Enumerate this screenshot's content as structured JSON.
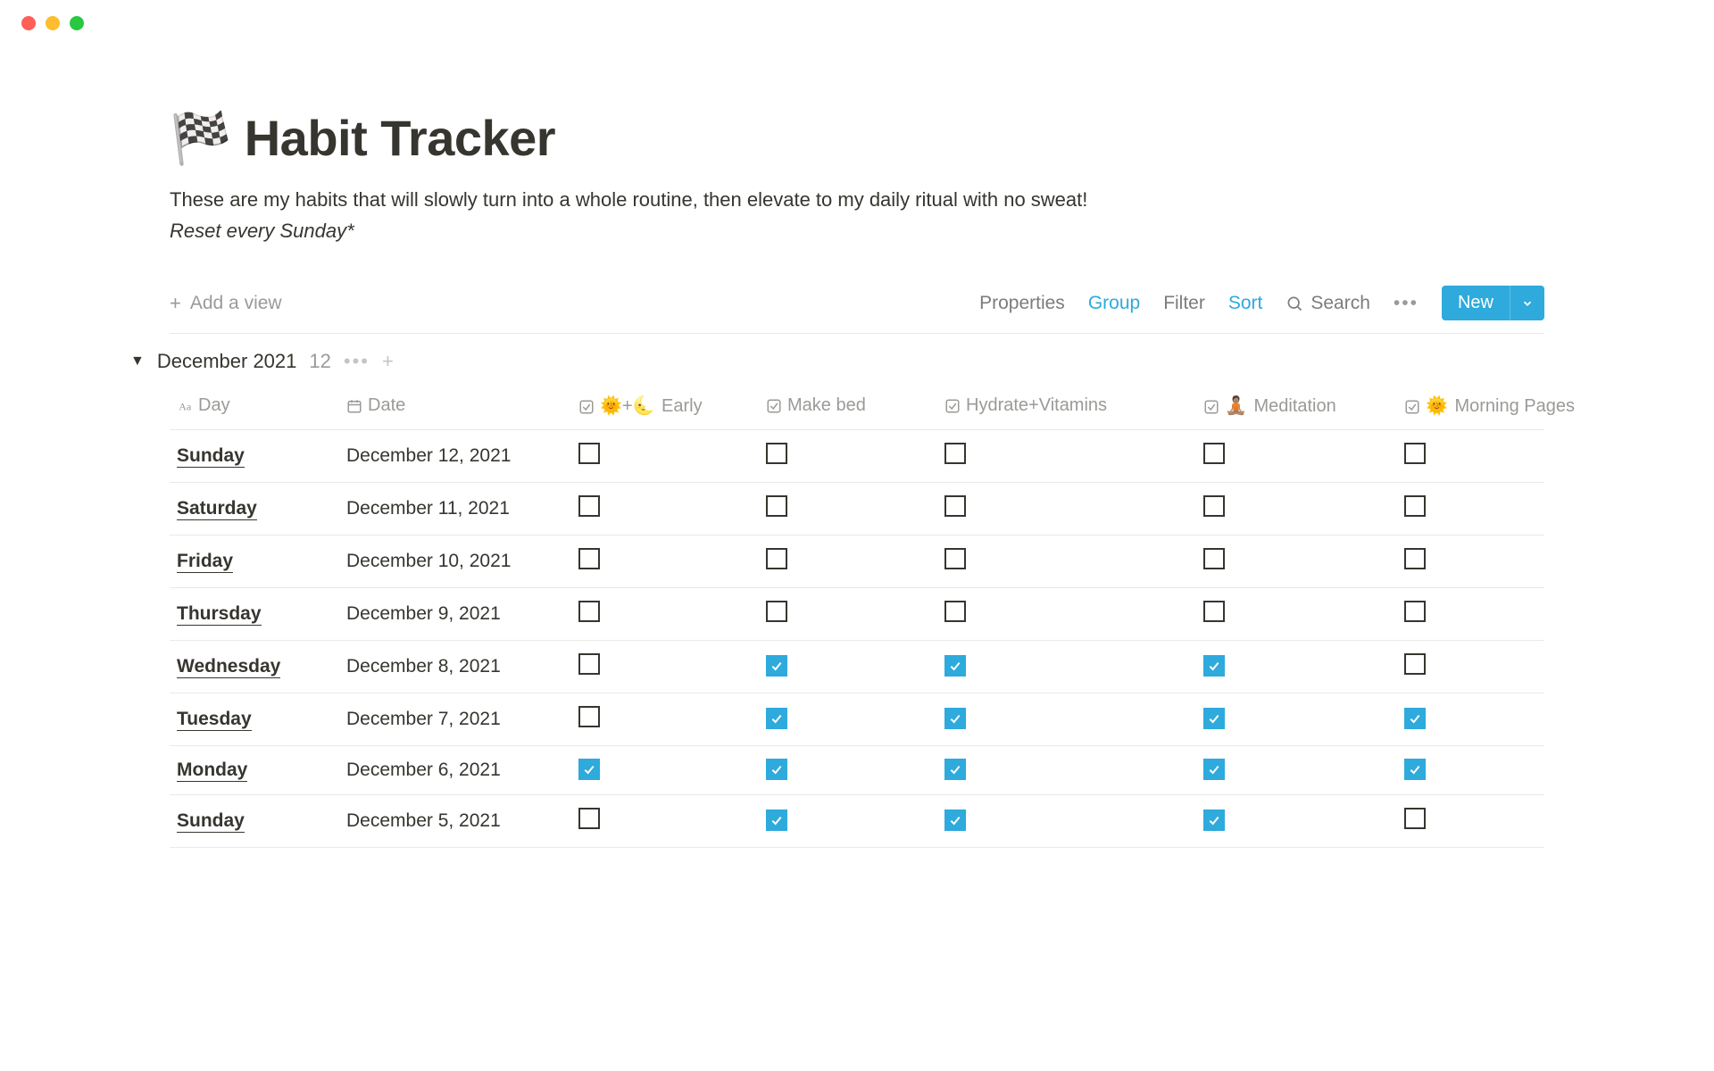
{
  "page": {
    "icon": "🏁",
    "title": "Habit Tracker",
    "description": "These are my habits that will slowly turn into a whole routine, then elevate to my daily ritual with no sweat!",
    "subtitle": "Reset every Sunday*"
  },
  "toolbar": {
    "add_view": "Add a view",
    "properties": "Properties",
    "group": "Group",
    "filter": "Filter",
    "sort": "Sort",
    "search": "Search",
    "new": "New"
  },
  "group": {
    "label": "December 2021",
    "count": "12"
  },
  "columns": [
    {
      "key": "day",
      "label": "Day",
      "icon_type": "title"
    },
    {
      "key": "date",
      "label": "Date",
      "icon_type": "date"
    },
    {
      "key": "early",
      "label": "Early",
      "icon_type": "checkbox",
      "emoji": "🌞+🌜"
    },
    {
      "key": "makebed",
      "label": "Make bed",
      "icon_type": "checkbox",
      "emoji": ""
    },
    {
      "key": "hydrate",
      "label": "Hydrate+Vitamins",
      "icon_type": "checkbox",
      "emoji": ""
    },
    {
      "key": "meditation",
      "label": "Meditation",
      "icon_type": "checkbox",
      "emoji": "🧘🏽"
    },
    {
      "key": "morning",
      "label": "Morning Pages",
      "icon_type": "checkbox",
      "emoji": "🌞"
    }
  ],
  "rows": [
    {
      "day": "Sunday",
      "date": "December 12, 2021",
      "early": false,
      "makebed": false,
      "hydrate": false,
      "meditation": false,
      "morning": false
    },
    {
      "day": "Saturday",
      "date": "December 11, 2021",
      "early": false,
      "makebed": false,
      "hydrate": false,
      "meditation": false,
      "morning": false
    },
    {
      "day": "Friday",
      "date": "December 10, 2021",
      "early": false,
      "makebed": false,
      "hydrate": false,
      "meditation": false,
      "morning": false
    },
    {
      "day": "Thursday",
      "date": "December 9, 2021",
      "early": false,
      "makebed": false,
      "hydrate": false,
      "meditation": false,
      "morning": false
    },
    {
      "day": "Wednesday",
      "date": "December 8, 2021",
      "early": false,
      "makebed": true,
      "hydrate": true,
      "meditation": true,
      "morning": false
    },
    {
      "day": "Tuesday",
      "date": "December 7, 2021",
      "early": false,
      "makebed": true,
      "hydrate": true,
      "meditation": true,
      "morning": true
    },
    {
      "day": "Monday",
      "date": "December 6, 2021",
      "early": true,
      "makebed": true,
      "hydrate": true,
      "meditation": true,
      "morning": true
    },
    {
      "day": "Sunday",
      "date": "December 5, 2021",
      "early": false,
      "makebed": true,
      "hydrate": true,
      "meditation": true,
      "morning": false
    }
  ]
}
